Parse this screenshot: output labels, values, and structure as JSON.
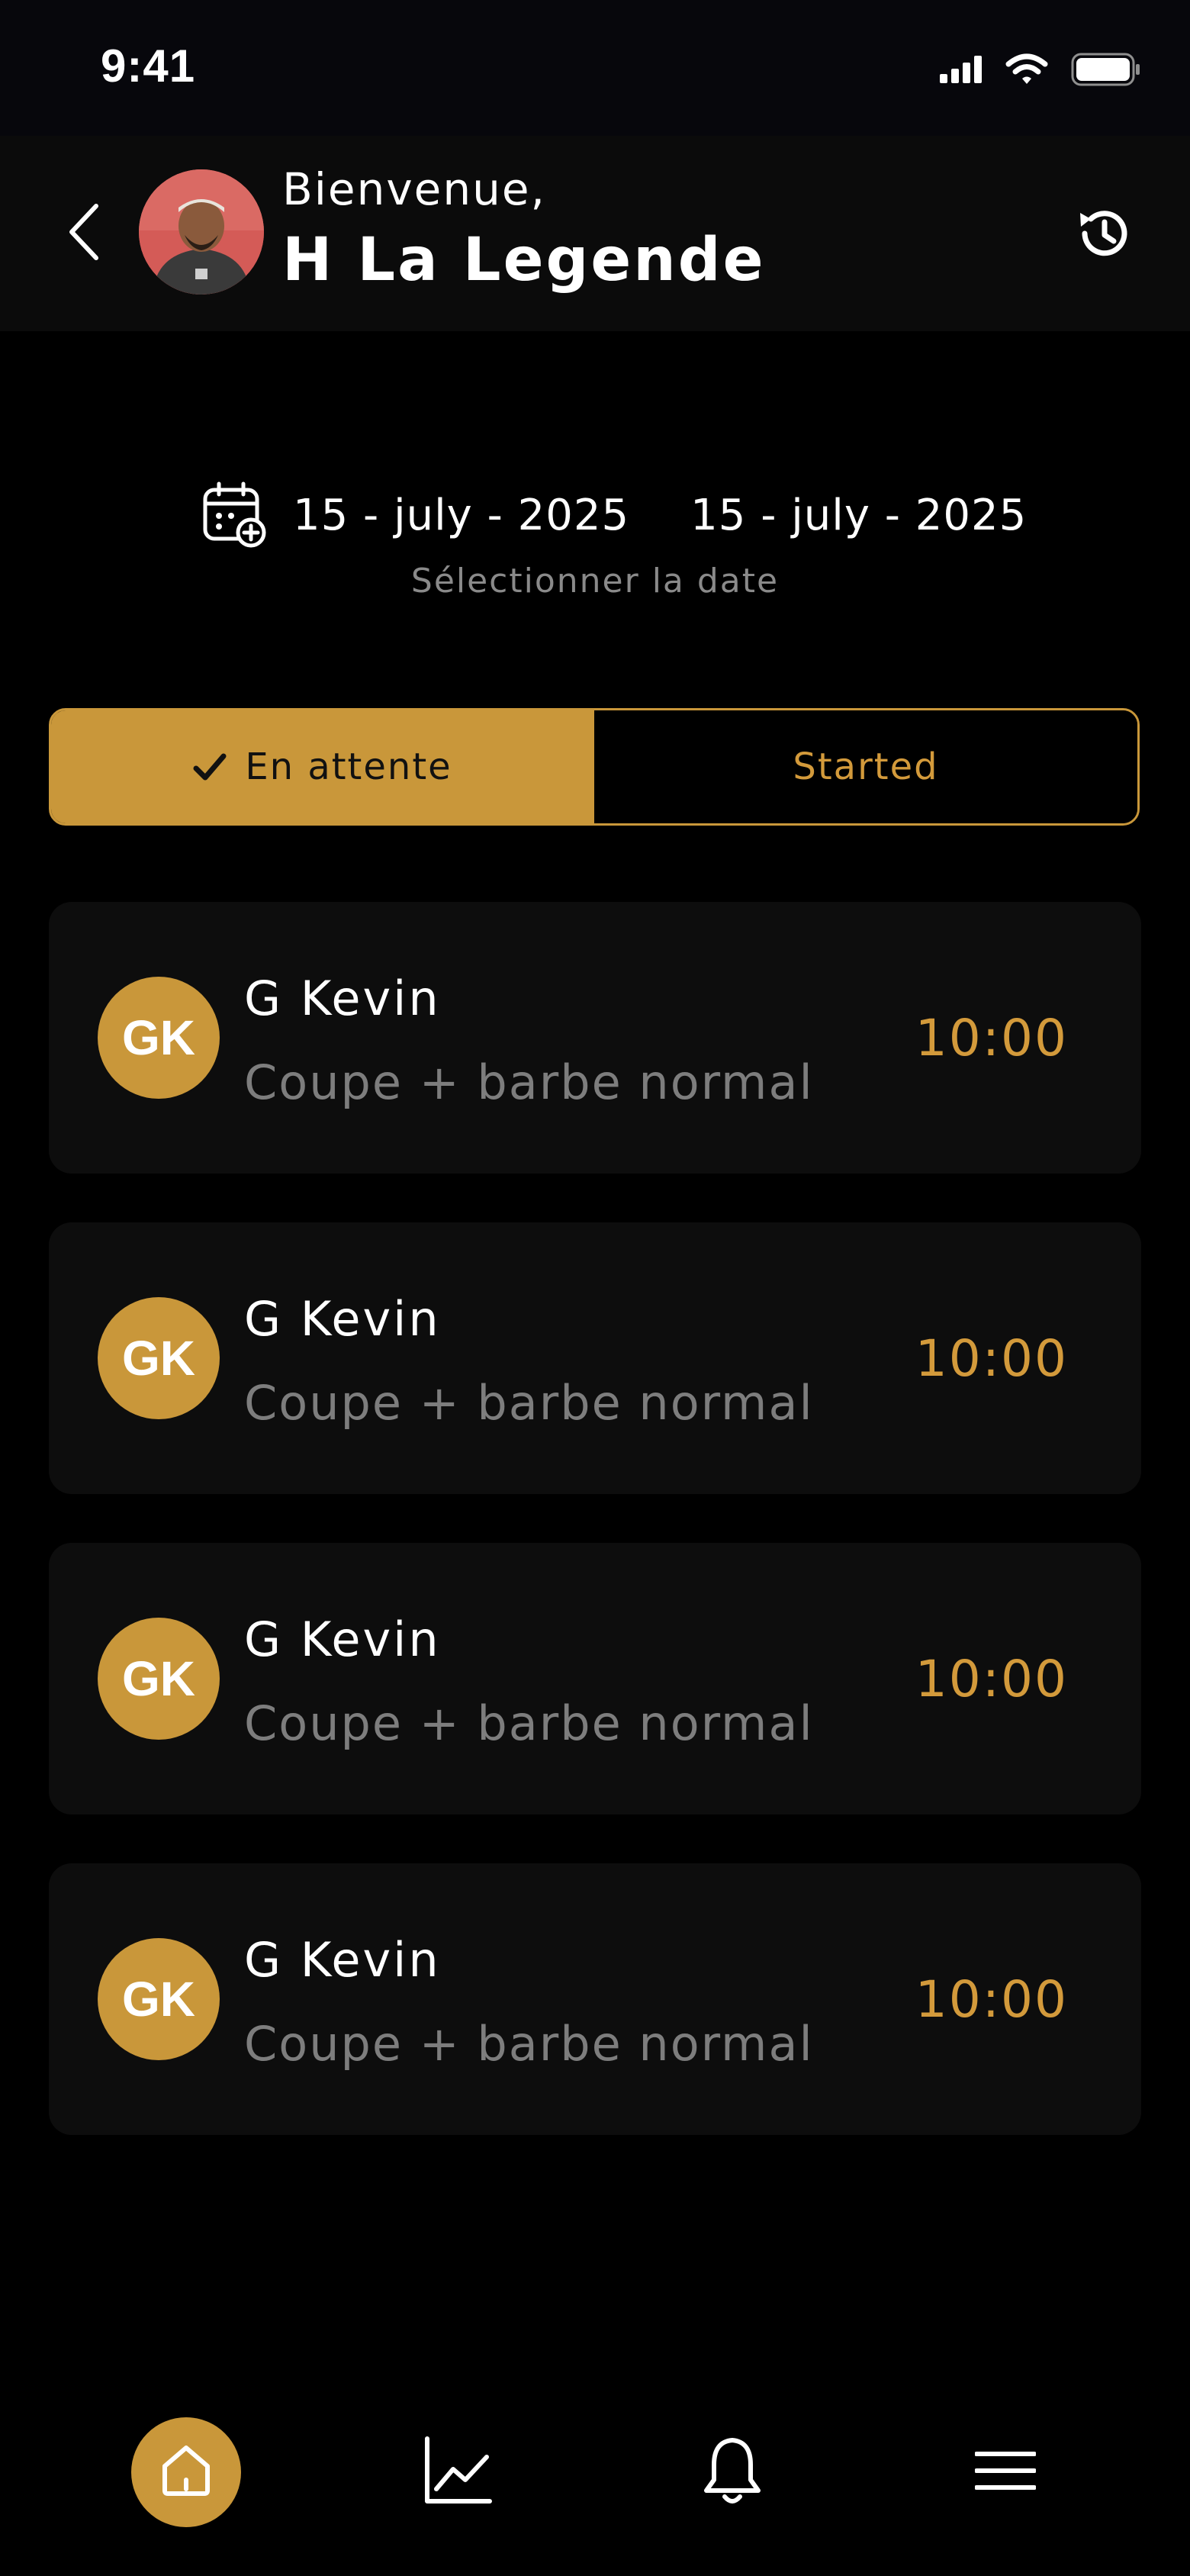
{
  "status_bar": {
    "time": "9:41"
  },
  "header": {
    "welcome": "Bienvenue,",
    "user_name": "H La Legende",
    "icons": {
      "back": "chevron-left-icon",
      "history": "history-icon"
    }
  },
  "date_filter": {
    "start_date": "15 - july - 2025",
    "end_date": "15 - july - 2025",
    "hint": "Sélectionner la date",
    "icon": "calendar-add-icon"
  },
  "tabs": [
    {
      "label": "En attente",
      "active": true
    },
    {
      "label": "Started",
      "active": false
    }
  ],
  "appointments": [
    {
      "initials": "GK",
      "client": "G Kevin",
      "service": "Coupe + barbe normal",
      "time": "10:00"
    },
    {
      "initials": "GK",
      "client": "G Kevin",
      "service": "Coupe + barbe normal",
      "time": "10:00"
    },
    {
      "initials": "GK",
      "client": "G Kevin",
      "service": "Coupe + barbe normal",
      "time": "10:00"
    },
    {
      "initials": "GK",
      "client": "G Kevin",
      "service": "Coupe + barbe normal",
      "time": "10:00"
    }
  ],
  "bottom_nav": [
    {
      "icon": "home-icon",
      "active": true
    },
    {
      "icon": "chart-line-icon",
      "active": false
    },
    {
      "icon": "bell-icon",
      "active": false
    },
    {
      "icon": "menu-icon",
      "active": false
    }
  ],
  "colors": {
    "accent": "#c9973a",
    "accent_text": "#d39a3b",
    "background": "#000000",
    "card": "#0d0d0d",
    "muted_text": "#7d7d7d"
  }
}
